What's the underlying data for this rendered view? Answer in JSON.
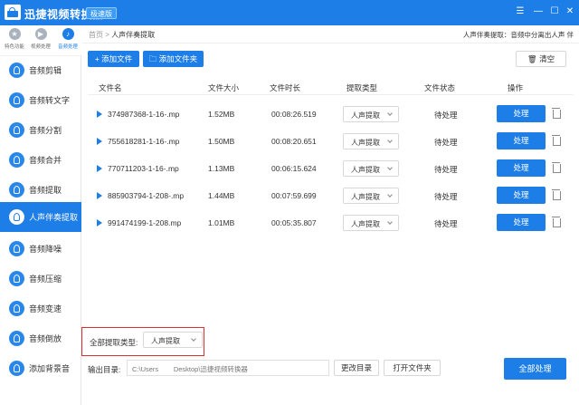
{
  "app": {
    "title": "迅捷视频转换器",
    "badge": "极速版",
    "window_controls": [
      "menu-icon",
      "minimize-icon",
      "maximize-icon",
      "close-icon"
    ]
  },
  "categories": [
    {
      "label": "特色功能",
      "icon": "star-icon",
      "active": false
    },
    {
      "label": "视频处理",
      "icon": "film-icon",
      "active": false
    },
    {
      "label": "音频处理",
      "icon": "audio-icon",
      "active": true
    }
  ],
  "sidebar": {
    "items": [
      {
        "label": "音频剪辑",
        "active": false
      },
      {
        "label": "音频转文字",
        "active": false
      },
      {
        "label": "音频分割",
        "active": false
      },
      {
        "label": "音频合并",
        "active": false
      },
      {
        "label": "音频提取",
        "active": false
      },
      {
        "label": "人声伴奏提取",
        "active": true
      },
      {
        "label": "音频降噪",
        "active": false
      },
      {
        "label": "音频压缩",
        "active": false
      },
      {
        "label": "音频变速",
        "active": false
      },
      {
        "label": "音频倒放",
        "active": false
      },
      {
        "label": "添加背景音",
        "active": false
      }
    ]
  },
  "breadcrumb": {
    "home": "首页",
    "sep": ">",
    "current": "人声伴奏提取"
  },
  "tip": "人声伴奏提取：音频中分离出人声 伴",
  "toolbar": {
    "add_file": "添加文件",
    "add_folder": "添加文件夹",
    "clear": "清空"
  },
  "table": {
    "headers": {
      "name": "文件名",
      "size": "文件大小",
      "duration": "文件时长",
      "type": "提取类型",
      "status": "文件状态",
      "action": "操作"
    },
    "rows": [
      {
        "name": "374987368-1-16-.mp",
        "size": "1.52MB",
        "duration": "00:08:26.519",
        "type": "人声提取",
        "status": "待处理",
        "action": "处理"
      },
      {
        "name": "755618281-1-16-.mp",
        "size": "1.50MB",
        "duration": "00:08:20.651",
        "type": "人声提取",
        "status": "待处理",
        "action": "处理"
      },
      {
        "name": "770711203-1-16-.mp",
        "size": "1.13MB",
        "duration": "00:06:15.624",
        "type": "人声提取",
        "status": "待处理",
        "action": "处理"
      },
      {
        "name": "885903794-1-208-.mp",
        "size": "1.44MB",
        "duration": "00:07:59.699",
        "type": "人声提取",
        "status": "待处理",
        "action": "处理"
      },
      {
        "name": "991474199-1-208.mp",
        "size": "1.01MB",
        "duration": "00:05:35.807",
        "type": "人声提取",
        "status": "待处理",
        "action": "处理"
      }
    ]
  },
  "bottom": {
    "all_type_label": "全部提取类型:",
    "all_type_value": "人声提取",
    "output_label": "输出目录:",
    "output_path": "C:\\Users        Desktop\\迅捷视频转换器",
    "change_dir": "更改目录",
    "open_folder": "打开文件夹",
    "process_all": "全部处理"
  },
  "colors": {
    "accent": "#1e7ee8",
    "highlight_border": "#d9312c"
  }
}
